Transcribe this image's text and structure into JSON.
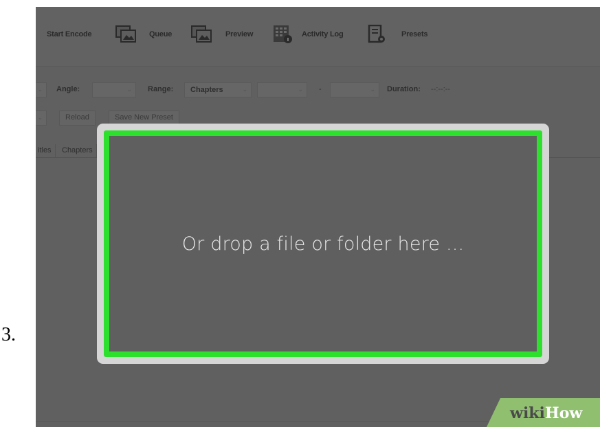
{
  "step": {
    "number": "3."
  },
  "toolbar": {
    "start_encode": "Start Encode",
    "queue": "Queue",
    "preview": "Preview",
    "activity_log": "Activity Log",
    "presets": "Presets"
  },
  "source_row": {
    "angle_label": "Angle:",
    "range_label": "Range:",
    "range_value": "Chapters",
    "dash": "-",
    "duration_label": "Duration:",
    "duration_value": "--:--:--"
  },
  "preset_row": {
    "reload": "Reload",
    "save_new_preset": "Save New Preset"
  },
  "tabs": [
    "itles",
    "Chapters"
  ],
  "dropzone": {
    "text": "Or drop a file or folder here ..."
  },
  "watermark": {
    "wiki": "wiki",
    "how": "How"
  },
  "colors": {
    "overlay": "#606060",
    "drop_border": "#2ee02e",
    "drop_frame": "#d6d6d6",
    "badge_green": "#8fbf6f"
  },
  "icons": [
    "start-encode-icon",
    "queue-icon",
    "preview-icon",
    "activity-log-icon",
    "presets-icon",
    "dropdown-arrow-icon"
  ]
}
